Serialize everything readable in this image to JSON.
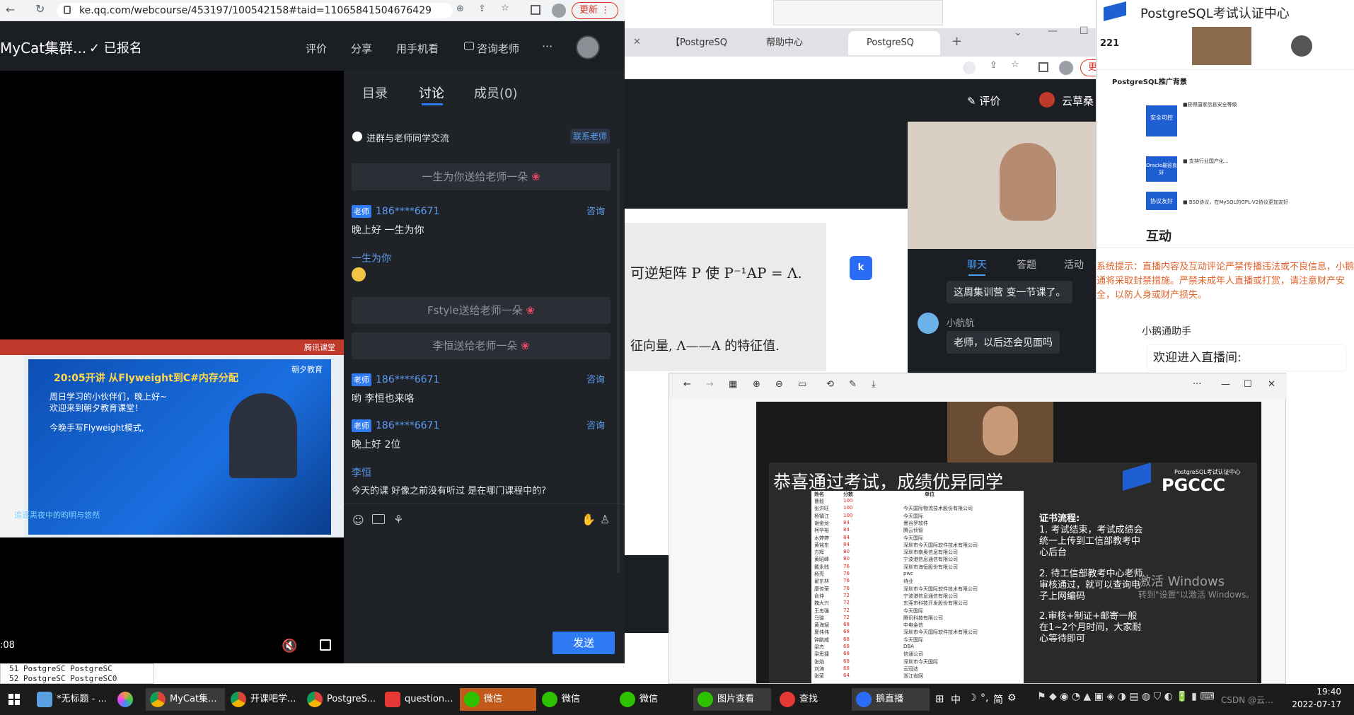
{
  "left_browser": {
    "url": "ke.qq.com/webcourse/453197/100542158#taid=11065841504676429",
    "update_label": "更新",
    "course_title": "MyCat集群...",
    "enrolled": "✓ 已报名",
    "header_links": [
      "评价",
      "分享",
      "用手机看",
      "咨询老师",
      "···"
    ],
    "video_time": ":08",
    "slide": {
      "headline": "20:05开讲  从Flyweight到C#内存分配",
      "brand": "朝夕教育",
      "greeting": "周日学习的小伙伴们，晚上好~",
      "welcome": "欢迎来到朝夕教育课堂！",
      "tonight": "今晚手写Flyweight模式,",
      "footer": "追逐黑夜中的昀明与悠然",
      "tencent": "腾讯课堂"
    },
    "code_lines": [
      "51  PostgreSC PostgreSC",
      "52  PostgreSC PostgreSC0"
    ],
    "chat": {
      "tabs": [
        "目录",
        "讨论",
        "成员(0)"
      ],
      "group_notice": "进群与老师同学交流",
      "contact": "联系老师",
      "gifts": [
        "一生为你送给老师一朵",
        "Fstyle送给老师一朵",
        "李恒送给老师一朵"
      ],
      "teacher_badge": "老师",
      "ask_label": "咨询",
      "messages": [
        {
          "name": "186****6671",
          "text": "晚上好   一生为你"
        },
        {
          "name": "一生为你",
          "text": ""
        },
        {
          "name": "186****6671",
          "text": "哟   李恒也来咯"
        },
        {
          "name": "186****6671",
          "text": "晚上好   2位"
        },
        {
          "name": "李恒",
          "text": "今天的课   好像之前没有听过    是在哪门课程中的?"
        }
      ],
      "send_label": "发送"
    }
  },
  "right_browser": {
    "tabs": [
      "【PostgreSQ",
      "帮助中心",
      "PostgreSQ"
    ],
    "update_label": "更新",
    "eval_label": "评价",
    "user_name": "云草桑",
    "math_line1": "可逆矩阵 P 使 P⁻¹AP = Λ.",
    "math_line2": "征向量, Λ——A 的特征值.",
    "chat_tabs": [
      "聊天",
      "答题",
      "活动"
    ],
    "chat": [
      {
        "name": "",
        "text": "这周集训营 变一节课了。"
      },
      {
        "name": "小航航",
        "text": "老师，以后还会见面吗"
      }
    ]
  },
  "pgccc_window": {
    "title": "PostgreSQL考试认证中心",
    "number": "221",
    "ppt_title": "PostgreSQL推广背景",
    "tags": [
      "安全可控",
      "Oracle最容良好",
      "协议友好"
    ],
    "tag_lines": [
      "■获得国家信息安全等级",
      "■ 支持行业国产化...",
      "■ BSD协议，在MySQL的GPL-V2协议更加友好"
    ],
    "interact": "互动",
    "notice": "系统提示：直播内容及互动评论严禁传播违法或不良信息，小鹅通将采取封禁措施。严禁未成年人直播或打赏，请注意财产安全，以防人身或财产损失。",
    "assistant": "小鹅通助手",
    "welcome": "欢迎进入直播间:"
  },
  "viewer": {
    "slide_title": "恭喜通过考试，成绩优异同学",
    "logo": "PGCCC",
    "logo_sub": "PostgreSQL考试认证中心",
    "table_headers": [
      "姓名",
      "分数",
      "单位"
    ],
    "rows": [
      [
        "曹毅",
        "100",
        ""
      ],
      [
        "张洪旺",
        "100",
        "今天国际物流技术股份有限公司"
      ],
      [
        "杨镇江",
        "100",
        "今天国际"
      ],
      [
        "谢金龙",
        "84",
        "曼谷罗软件"
      ],
      [
        "柯华裕",
        "84",
        "腾云侦智"
      ],
      [
        "水婷婷",
        "84",
        "今天国际"
      ],
      [
        "黄铭东",
        "84",
        "深圳市今天国际软件技术有限公司"
      ],
      [
        "方辉",
        "80",
        "深圳市南奥信息有限公司"
      ],
      [
        "黄昭峰",
        "80",
        "宁波港信息通信有限公司"
      ],
      [
        "戴永贱",
        "76",
        "深圳市海恒股份有限公司"
      ],
      [
        "杨亮",
        "76",
        "pwc"
      ],
      [
        "翟东林",
        "76",
        "待业"
      ],
      [
        "康传荣",
        "76",
        "深圳市今天国际软件技术有限公司"
      ],
      [
        "俞仲",
        "72",
        "宁波港信息通信有限公司"
      ],
      [
        "魏大兴",
        "72",
        "东莞市科技开发股份有限公司"
      ],
      [
        "王忠强",
        "72",
        "今天国际"
      ],
      [
        "马骏",
        "72",
        "腾讯科技有限公司"
      ],
      [
        "黄海斌",
        "68",
        "中电金信"
      ],
      [
        "夏伟伟",
        "68",
        "深圳市今天国际软件技术有限公司"
      ],
      [
        "钟鹏威",
        "68",
        "今天国际"
      ],
      [
        "梁杰",
        "68",
        "DBA"
      ],
      [
        "梁思捷",
        "68",
        "信通公司"
      ],
      [
        "张焰",
        "68",
        "深圳市今天国际"
      ],
      [
        "刘涛",
        "68",
        "云冠达"
      ],
      [
        "张莹",
        "64",
        "浙江省网"
      ]
    ],
    "cert_title": "证书流程:",
    "cert_steps": [
      "1. 考试结束，考试成绩会统一上传到工信部教考中心后台",
      "2. 待工信部教考中心老师审核通过，就可以查询电子上网编码",
      "2.审核+制证+邮寄一般在1~2个月时间，大家耐心等待即可"
    ],
    "watermark1": "激活 Windows",
    "watermark2": "转到\"设置\"以激活 Windows。"
  },
  "taskbar": {
    "items": [
      "*无标题 - ...",
      "",
      "MyCat集...",
      "开课吧学...",
      "PostgreS...",
      "question...",
      "微信",
      "微信",
      "微信",
      "图片查看",
      "查找",
      "鹅直播"
    ],
    "ime": "中",
    "lang": "简",
    "time": "19:40",
    "date": "2022-07-17",
    "csdn": "CSDN @云草桑"
  },
  "colors": {
    "accent": "#2f7bf5",
    "update": "#d93025",
    "taskbar": "#1c1c1c"
  }
}
